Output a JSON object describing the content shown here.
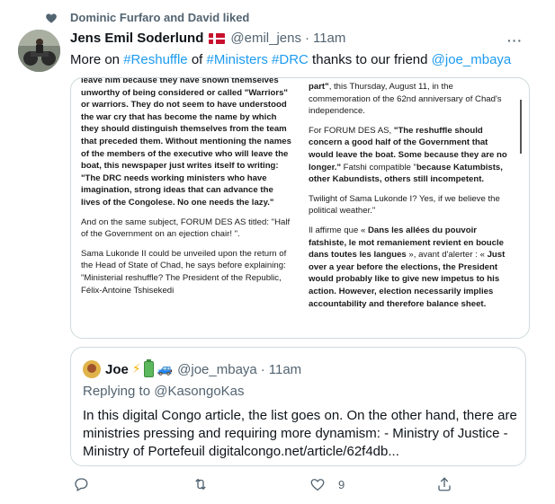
{
  "social_context": {
    "text": "Dominic Furfaro and David liked"
  },
  "tweet": {
    "display_name": "Jens Emil Soderlund",
    "handle": "@emil_jens",
    "separator": "·",
    "time": "11am",
    "more": "···",
    "text": {
      "part1": "More on ",
      "tag1": "#Reshuffle",
      "part2": " of ",
      "tag2": "#Ministers",
      "space": " ",
      "tag3": "#DRC",
      "part3": " thanks to our friend ",
      "mention": "@joe_mbaya"
    }
  },
  "document": {
    "left": {
      "p1": "leave him because they have shown themselves unworthy of being considered or called \"Warriors\" or warriors. They do not seem to have understood the war cry that has become the name by which they should distinguish themselves from the team that preceded them. Without mentioning the names of the members of the executive who will leave the boat, this newspaper just writes itself to writing: \"The DRC needs working ministers who have imagination, strong ideas that can advance the lives of the Congolese. No one needs the lazy.\"",
      "p2": "And on the same subject, FORUM DES AS titled: \"Half of the Government on an ejection chair! \".",
      "p3": "Sama Lukonde II could be unveiled upon the return of the Head of State of Chad, he says before explaining: \"Ministerial reshuffle? The President of the Republic, Félix-Antoine Tshisekedi"
    },
    "right": {
      "p1_bold": "part\"",
      "p1_rest": ", this Thursday, August 11, in the commemoration of the 62nd anniversary of Chad's independence.",
      "p2_a": "For FORUM DES AS, ",
      "p2_bold": "\"The reshuffle should concern a good half of the Government that would leave the boat. Some because they are no longer.\"",
      "p2_b": " Fatshi compatible \"",
      "p2_bold2": "because Katumbists, other Kabundists, others still incompetent.",
      "p3": "Twilight of Sama Lukonde I? Yes, if we believe the political weather.\"",
      "p4_a": "Il affirme que « ",
      "p4_bold": "Dans les allées du pouvoir fatshiste, le mot remaniement revient en boucle dans toutes les langues",
      "p4_b": " », avant d'alerter : « ",
      "p4_bold2": "Just over a year before the elections, the President would probably like to give new impetus to his action. However, election necessarily implies accountability and therefore balance sheet."
    }
  },
  "quote": {
    "name": "Joe",
    "emoji1": "⚡",
    "emoji3": "🚙",
    "handle": "@joe_mbaya",
    "separator": "·",
    "time": "11am",
    "replying_prefix": "Replying to ",
    "replying_handle": "@KasongoKas",
    "text": "In this digital Congo article, the list goes on. On the other hand, there are ministries pressing and requiring more dynamism: - Ministry of Justice - Ministry of Portefeuil  digitalcongo.net/article/62f4db..."
  },
  "actions": {
    "like_count": "9"
  },
  "colors": {
    "link": "#1d9bf0",
    "muted": "#536471",
    "border": "#cfd9de"
  }
}
